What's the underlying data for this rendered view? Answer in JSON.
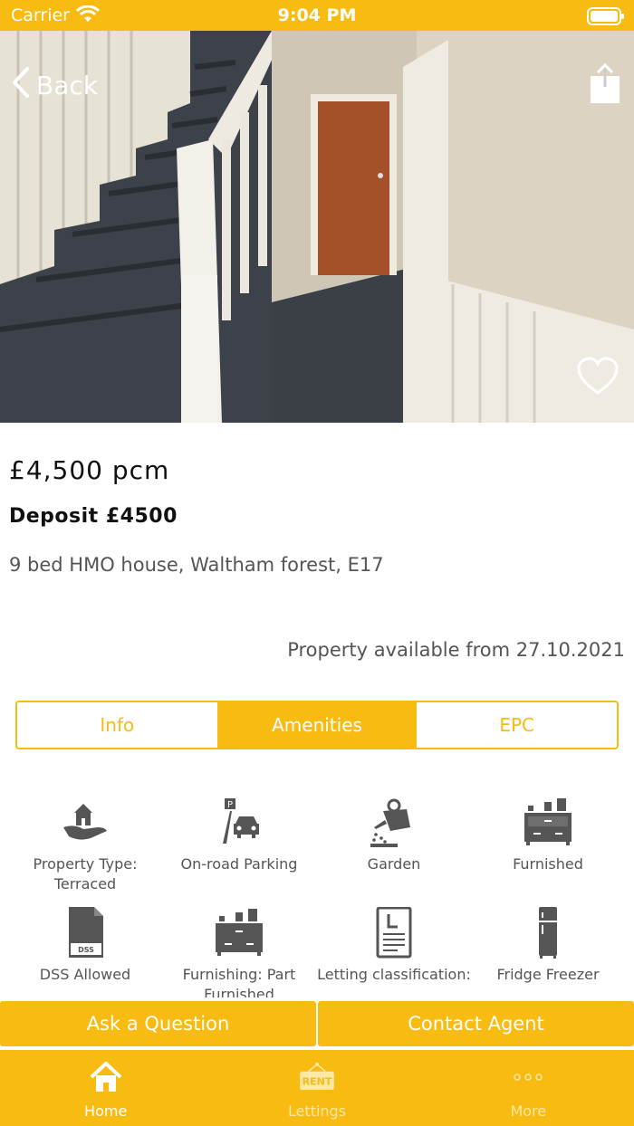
{
  "status_bar": {
    "carrier": "Carrier",
    "time": "9:04 PM"
  },
  "nav": {
    "back_label": "Back"
  },
  "listing": {
    "price": "£4,500 pcm",
    "deposit": "Deposit £4500",
    "summary": "9 bed HMO house, Waltham forest, E17",
    "available": "Property available from 27.10.2021"
  },
  "tabs": [
    {
      "label": "Info",
      "active": false
    },
    {
      "label": "Amenities",
      "active": true
    },
    {
      "label": "EPC",
      "active": false
    }
  ],
  "amenities": [
    {
      "label": "Property Type: Terraced",
      "icon": "property-type-icon"
    },
    {
      "label": "On-road Parking",
      "icon": "parking-icon"
    },
    {
      "label": "Garden",
      "icon": "garden-icon"
    },
    {
      "label": "Furnished",
      "icon": "furniture-icon"
    },
    {
      "label": "DSS Allowed",
      "icon": "dss-document-icon"
    },
    {
      "label": "Furnishing: Part Furnished",
      "icon": "furniture-icon"
    },
    {
      "label": "Letting classification:",
      "icon": "letting-document-icon"
    },
    {
      "label": "Fridge Freezer",
      "icon": "fridge-icon"
    }
  ],
  "actions": {
    "ask": "Ask a Question",
    "contact": "Contact Agent"
  },
  "tabbar": [
    {
      "label": "Home",
      "icon": "home-icon",
      "active": true
    },
    {
      "label": "Lettings",
      "icon": "rent-sign-icon",
      "active": false,
      "icon_text": "RENT"
    },
    {
      "label": "More",
      "icon": "more-dots-icon",
      "active": false
    }
  ],
  "colors": {
    "accent": "#f7bb12",
    "text_muted": "#555555"
  }
}
